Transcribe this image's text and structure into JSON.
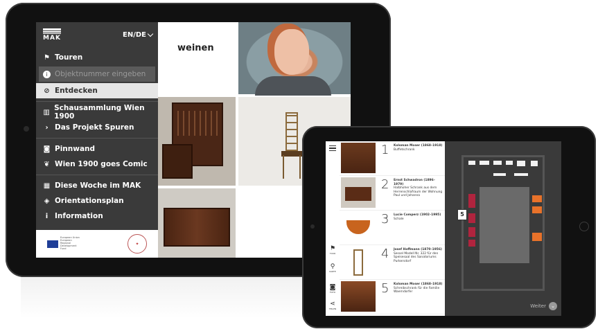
{
  "brand": {
    "logo_text": "MAK",
    "lang": "EN/DE"
  },
  "nav": {
    "items_top": [
      {
        "label": "Touren",
        "icon": "flag-icon"
      },
      {
        "label": "Objektnummer eingeben",
        "icon": "info-circle-icon"
      },
      {
        "label": "Entdecken",
        "icon": "compass-icon"
      }
    ],
    "items_mid": [
      {
        "label": "Schausammlung Wien 1900",
        "icon": "museum-icon"
      },
      {
        "label": "Das Projekt Spuren",
        "icon": "chevron-right-icon"
      }
    ],
    "items_social": [
      {
        "label": "Pinnwand",
        "icon": "camera-icon"
      },
      {
        "label": "Wien 1900 goes Comic",
        "icon": "bird-icon"
      }
    ],
    "items_info": [
      {
        "label": "Diese Woche im MAK",
        "icon": "calendar-icon"
      },
      {
        "label": "Orientationsplan",
        "icon": "layers-icon"
      },
      {
        "label": "Information",
        "icon": "info-icon"
      }
    ],
    "footer_eu": "European Union European Regional Development Fund"
  },
  "discover": {
    "headline": "weinen"
  },
  "tour": {
    "rail": [
      {
        "label": "TOUR",
        "icon": "flag-icon"
      },
      {
        "label": "KARTE",
        "icon": "pin-icon"
      },
      {
        "label": "FOTO",
        "icon": "camera-icon"
      },
      {
        "label": "TEILEN",
        "icon": "share-icon"
      }
    ],
    "stops": [
      {
        "num": "1",
        "title": "Koloman Moser (1868–1918)",
        "desc": "Buffetschrank"
      },
      {
        "num": "2",
        "title": "Ernst Schwadron (1896–1979)",
        "desc": "Halbhoher Schrank aus dem Herrenschlafraum der Wohnung Paul und Johanna"
      },
      {
        "num": "3",
        "title": "Lucie Comperz (1902–1995)",
        "desc": "Schale"
      },
      {
        "num": "4",
        "title": "Josef Hoffmann (1870–1956)",
        "desc": "Sessel Modell Nr. 322 für den Speisesaal des Sanatoriums Purkersdorf"
      },
      {
        "num": "5",
        "title": "Koloman Moser (1868–1918)",
        "desc": "Schreibschrank für die Familie Waerndorfer"
      }
    ],
    "map_marker": "5",
    "next_label": "Weiter"
  },
  "colors": {
    "sidebar": "#3a3a3a",
    "room_red": "#b0243e",
    "room_orange": "#e8722a"
  }
}
